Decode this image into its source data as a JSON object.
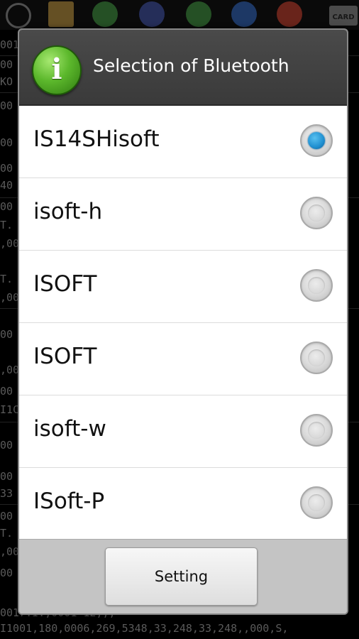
{
  "background": {
    "toolbar": {
      "icons": [
        "refresh-icon",
        "folder-icon",
        "upload-icon",
        "sort-icon",
        "download-icon",
        "bluetooth-icon",
        "settings-icon"
      ],
      "card_label": "CARD"
    },
    "lines": [
      "001",
      "00",
      "KO",
      "00",
      "00",
      "00",
      "40",
      "00",
      "T.",
      ",00",
      "T.",
      ",00",
      "00",
      ",00",
      "00",
      "I1C",
      "00",
      "00",
      "33",
      "00",
      "T.",
      ",00",
      "00",
      "0017.I.,0001 12,,,",
      "I1001,180,0006,269,5348,33,248,33,248,,000,S,"
    ]
  },
  "dialog": {
    "title": "Selection of Bluetooth",
    "devices": [
      {
        "label": "IS14SHisoft",
        "selected": true
      },
      {
        "label": "isoft-h",
        "selected": false
      },
      {
        "label": "ISOFT",
        "selected": false
      },
      {
        "label": "ISOFT",
        "selected": false
      },
      {
        "label": "isoft-w",
        "selected": false
      },
      {
        "label": "ISoft-P",
        "selected": false
      }
    ],
    "setting_button": "Setting"
  },
  "colors": {
    "header_bg": "#3f3f3f",
    "radio_selected": "#1f8fd0",
    "info_icon_green": "#5cb82c"
  }
}
